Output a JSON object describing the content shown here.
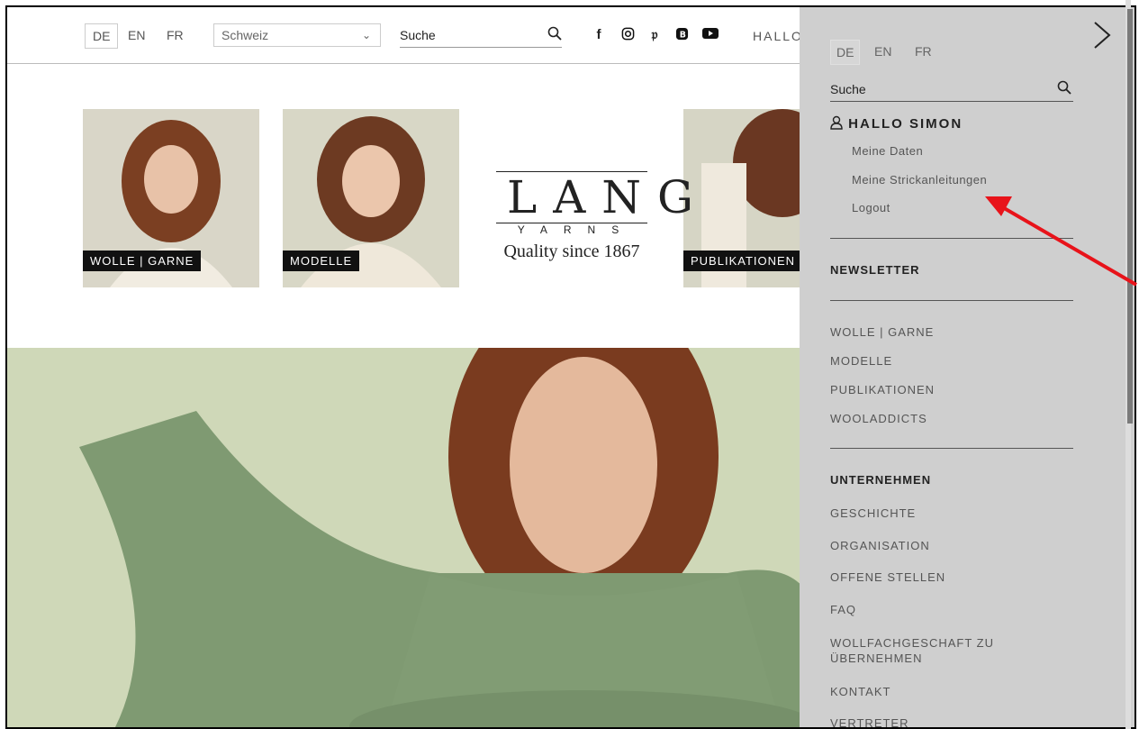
{
  "topbar": {
    "languages": [
      "DE",
      "EN",
      "FR"
    ],
    "country": "Schweiz",
    "search_label": "Suche",
    "social_icons": [
      "facebook-icon",
      "instagram-icon",
      "pinterest-icon",
      "blog-icon",
      "youtube-icon"
    ],
    "greeting_truncated": "HALLO"
  },
  "tiles": [
    {
      "label": "WOLLE | GARNE"
    },
    {
      "label": "MODELLE"
    },
    {
      "label": "PUBLIKATIONEN"
    }
  ],
  "logo": {
    "brand": "LANG",
    "sub": "YARNS",
    "tagline": "Quality since 1867"
  },
  "panel": {
    "languages": [
      "DE",
      "EN",
      "FR"
    ],
    "search_label": "Suche",
    "greeting": "HALLO SIMON",
    "account_links": [
      "Meine Daten",
      "Meine Strickanleitungen",
      "Logout"
    ],
    "newsletter": "NEWSLETTER",
    "nav": [
      "WOLLE | GARNE",
      "MODELLE",
      "PUBLIKATIONEN",
      "WOOLADDICTS"
    ],
    "company_heading": "UNTERNEHMEN",
    "company_links": [
      "GESCHICHTE",
      "ORGANISATION",
      "OFFENE STELLEN",
      "FAQ",
      "WOLLFACHGESCHAFT ZU ÜBERNEHMEN",
      "KONTAKT",
      "VERTRETER"
    ]
  },
  "colors": {
    "panel_bg": "#cfcfcf",
    "annotation_arrow": "#e8131a",
    "hero_bg": "#cdd6b6",
    "sweater_green": "#7f9a72"
  }
}
